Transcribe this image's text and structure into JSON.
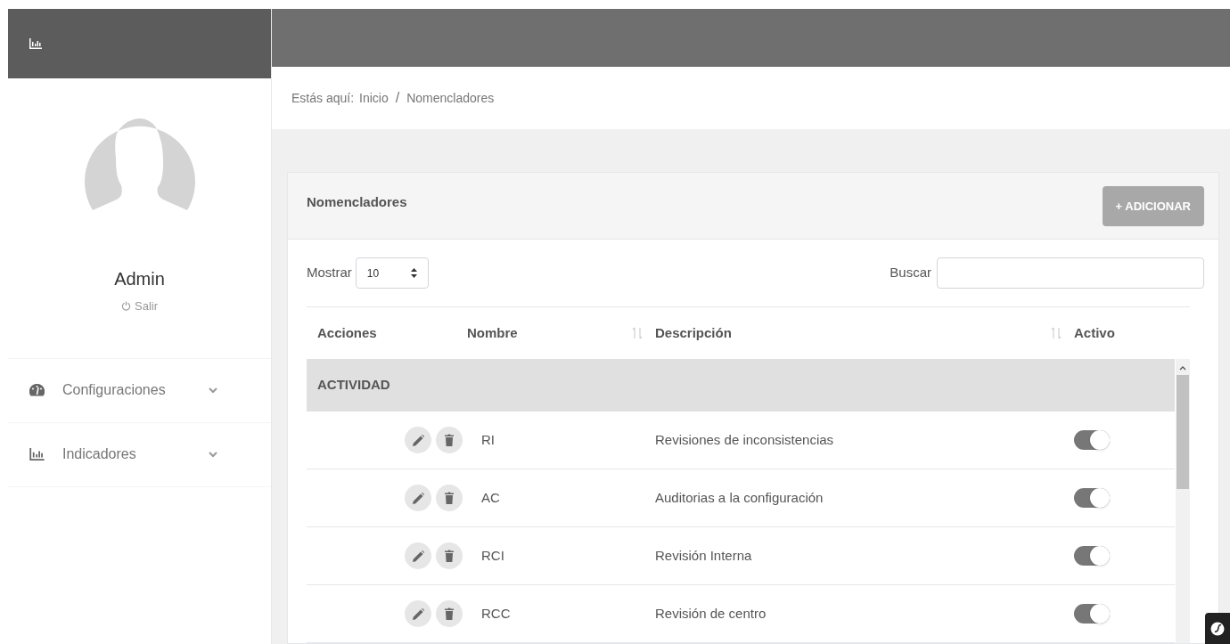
{
  "user": {
    "name": "Admin",
    "logout": "Salir"
  },
  "sidebar": {
    "items": [
      {
        "label": "Configuraciones",
        "expanded": false
      },
      {
        "label": "Indicadores",
        "expanded": false
      }
    ]
  },
  "breadcrumb": {
    "prefix": "Estás aquí:",
    "items": [
      "Inicio",
      "Nomencladores"
    ],
    "separator": "/"
  },
  "card": {
    "title": "Nomencladores",
    "add_button": "+ ADICIONAR"
  },
  "controls": {
    "show_label": "Mostrar",
    "page_size": "10",
    "search_label": "Buscar"
  },
  "table": {
    "columns": [
      {
        "label": "Acciones",
        "sortable": false
      },
      {
        "label": "Nombre",
        "sortable": true
      },
      {
        "label": "Descripción",
        "sortable": true
      },
      {
        "label": "Activo",
        "sortable": false
      }
    ],
    "group": "ACTIVIDAD",
    "rows": [
      {
        "name": "RI",
        "description": "Revisiones de inconsistencias",
        "active": true
      },
      {
        "name": "AC",
        "description": "Auditorias a la configuración",
        "active": true
      },
      {
        "name": "RCI",
        "description": "Revisión Interna",
        "active": true
      },
      {
        "name": "RCC",
        "description": "Revisión de centro",
        "active": true
      }
    ]
  }
}
